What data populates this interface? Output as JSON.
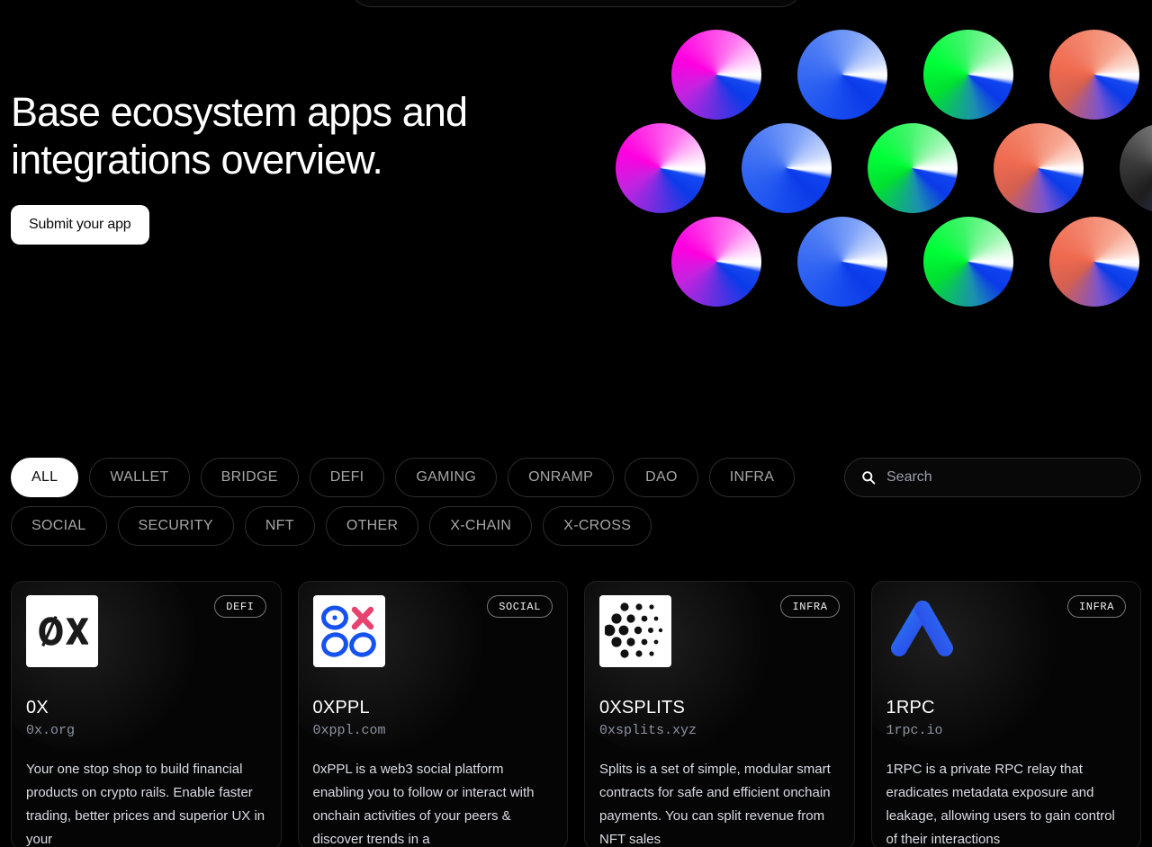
{
  "hero": {
    "title": "Base ecosystem apps and integrations overview.",
    "submit_label": "Submit your app"
  },
  "filters": {
    "row1": [
      {
        "label": "ALL",
        "active": true
      },
      {
        "label": "WALLET",
        "active": false
      },
      {
        "label": "BRIDGE",
        "active": false
      },
      {
        "label": "DEFI",
        "active": false
      },
      {
        "label": "GAMING",
        "active": false
      },
      {
        "label": "ONRAMP",
        "active": false
      },
      {
        "label": "DAO",
        "active": false
      },
      {
        "label": "INFRA",
        "active": false
      }
    ],
    "row2": [
      {
        "label": "SOCIAL",
        "active": false
      },
      {
        "label": "SECURITY",
        "active": false
      },
      {
        "label": "NFT",
        "active": false
      },
      {
        "label": "OTHER",
        "active": false
      },
      {
        "label": "X-CHAIN",
        "active": false
      },
      {
        "label": "X-CROSS",
        "active": false
      }
    ]
  },
  "search": {
    "placeholder": "Search",
    "value": "",
    "icon": "search-icon"
  },
  "cards": [
    {
      "name": "0X",
      "url": "0x.org",
      "badge": "DEFI",
      "description": "Your one stop shop to build financial products on crypto rails. Enable faster trading, better prices and superior UX in your"
    },
    {
      "name": "0XPPL",
      "url": "0xppl.com",
      "badge": "SOCIAL",
      "description": "0xPPL is a web3 social platform enabling you to follow or interact with onchain activities of your peers & discover trends in a"
    },
    {
      "name": "0XSPLITS",
      "url": "0xsplits.xyz",
      "badge": "INFRA",
      "description": "Splits is a set of simple, modular smart contracts for safe and efficient onchain payments. You can split revenue from NFT sales"
    },
    {
      "name": "1RPC",
      "url": "1rpc.io",
      "badge": "INFRA",
      "description": "1RPC is a private RPC relay that eradicates metadata exposure and leakage, allowing users to gain control of their interactions"
    }
  ],
  "colors": {
    "background": "#000000",
    "accent_blue": "#0b3ae8",
    "magenta": "#ff00e0",
    "green": "#00ff38",
    "salmon": "#ef6a4f",
    "card_border": "#202020",
    "pill_border": "#2e2e2e"
  },
  "hero_graphic": {
    "rows": [
      [
        "magenta",
        "blue",
        "green",
        "salmon"
      ],
      [
        "magenta",
        "blue",
        "green",
        "salmon",
        "gray"
      ],
      [
        "magenta",
        "blue",
        "green",
        "salmon"
      ]
    ]
  }
}
